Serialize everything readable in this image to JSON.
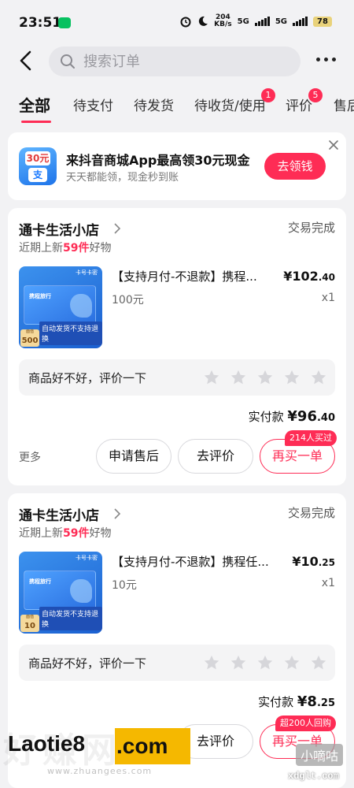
{
  "status_bar": {
    "time": "23:51",
    "net_speed_value": "204",
    "net_speed_unit": "KB/s",
    "sig1": "5G",
    "sig2": "5G",
    "battery": "78"
  },
  "search": {
    "placeholder": "搜索订单"
  },
  "tabs": [
    {
      "label": "全部",
      "active": true
    },
    {
      "label": "待支付"
    },
    {
      "label": "待发货"
    },
    {
      "label": "待收货/使用",
      "badge": "1"
    },
    {
      "label": "评价",
      "badge": "5"
    },
    {
      "label": "售后"
    }
  ],
  "promo": {
    "icon_coin": "30元",
    "icon_zhi": "支",
    "title": "来抖音商城App最高领30元现金",
    "subtitle": "天天都能领，现金秒到账",
    "button": "去领钱"
  },
  "orders": [
    {
      "shop_name": "通卡生活小店",
      "shop_sub_prefix": "近期上新",
      "shop_sub_count": "59件",
      "shop_sub_suffix": "好物",
      "status": "交易完成",
      "product_title": "【支持月付-不退款】携程...",
      "price_int": "¥102",
      "price_dec": ".40",
      "spec": "100元",
      "qty": "x1",
      "thumb": {
        "tag": "卡号卡密",
        "denom": "500",
        "denom_label": "面值",
        "foot": "自动发货不支持退换",
        "logo": "携程旅行"
      },
      "rate_prompt": "商品好不好，评价一下",
      "paid_label": "实付款",
      "paid_int": "¥96",
      "paid_dec": ".40",
      "more": "更多",
      "buttons": [
        "申请售后",
        "去评价",
        "再买一单"
      ],
      "rebuy_badge": "214人买过"
    },
    {
      "shop_name": "通卡生活小店",
      "shop_sub_prefix": "近期上新",
      "shop_sub_count": "59件",
      "shop_sub_suffix": "好物",
      "status": "交易完成",
      "product_title": "【支持月付-不退款】携程任...",
      "price_int": "¥10",
      "price_dec": ".25",
      "spec": "10元",
      "qty": "x1",
      "thumb": {
        "tag": "卡号卡密",
        "denom": "10",
        "denom_label": "面值",
        "foot": "自动发货不支持退换",
        "logo": "携程旅行"
      },
      "rate_prompt": "商品好不好，评价一下",
      "paid_label": "实付款",
      "paid_int": "¥8",
      "paid_dec": ".25",
      "buttons": [
        "去评价",
        "再买一单"
      ],
      "rebuy_badge": "超200人回购"
    }
  ],
  "watermarks": {
    "brand": "Laotie8",
    "brand_hl": ".com",
    "ghost": "好赚网",
    "site": "www.zhuangees.com",
    "wm2": "小嘀咕",
    "wm3": "xdglt.com"
  },
  "colors": {
    "accent": "#fe2c55",
    "page_bg": "#f2f2f4"
  }
}
